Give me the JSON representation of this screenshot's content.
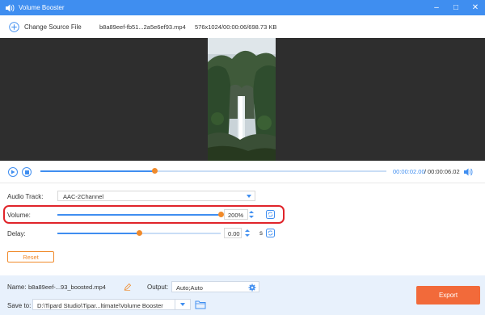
{
  "app": {
    "title": "Volume Booster",
    "colors": {
      "accent": "#3f8ef0",
      "titlebar": "#3f8ef0",
      "knob": "#f08a2a",
      "export": "#f26a3a",
      "highlight": "#e0242a"
    }
  },
  "window_controls": {
    "minimize": "–",
    "maximize": "□",
    "close": "✕"
  },
  "filebar": {
    "change_source_label": "Change Source File",
    "file_name": "b8a89eef-fb51...2a5e6ef93.mp4",
    "file_info": "576x1024/00:00:06/698.73 KB"
  },
  "playback": {
    "current_time": "00:00:02.00",
    "separator": "/",
    "total_time": "00:00:06.02",
    "progress": 0.33
  },
  "settings": {
    "audio_track": {
      "label": "Audio Track:",
      "value": "AAC-2Channel"
    },
    "volume": {
      "label": "Volume:",
      "value": "200%",
      "level": 1.0
    },
    "delay": {
      "label": "Delay:",
      "value": "0.00",
      "unit": "s",
      "level": 0.5
    },
    "reset_label": "Reset"
  },
  "bottom": {
    "name_label": "Name:",
    "name_value": "b8a89eef-...93_boosted.mp4",
    "output_label": "Output:",
    "output_value": "Auto;Auto",
    "save_label": "Save to:",
    "save_path": "D:\\Tipard Studio\\Tipar...ltimate\\Volume Booster",
    "export_label": "Export"
  },
  "icons": [
    "volume-booster-app-icon",
    "add-icon",
    "play-icon",
    "stop-icon",
    "speaker-icon",
    "sync-icon",
    "pencil-icon",
    "gear-icon",
    "folder-icon"
  ]
}
